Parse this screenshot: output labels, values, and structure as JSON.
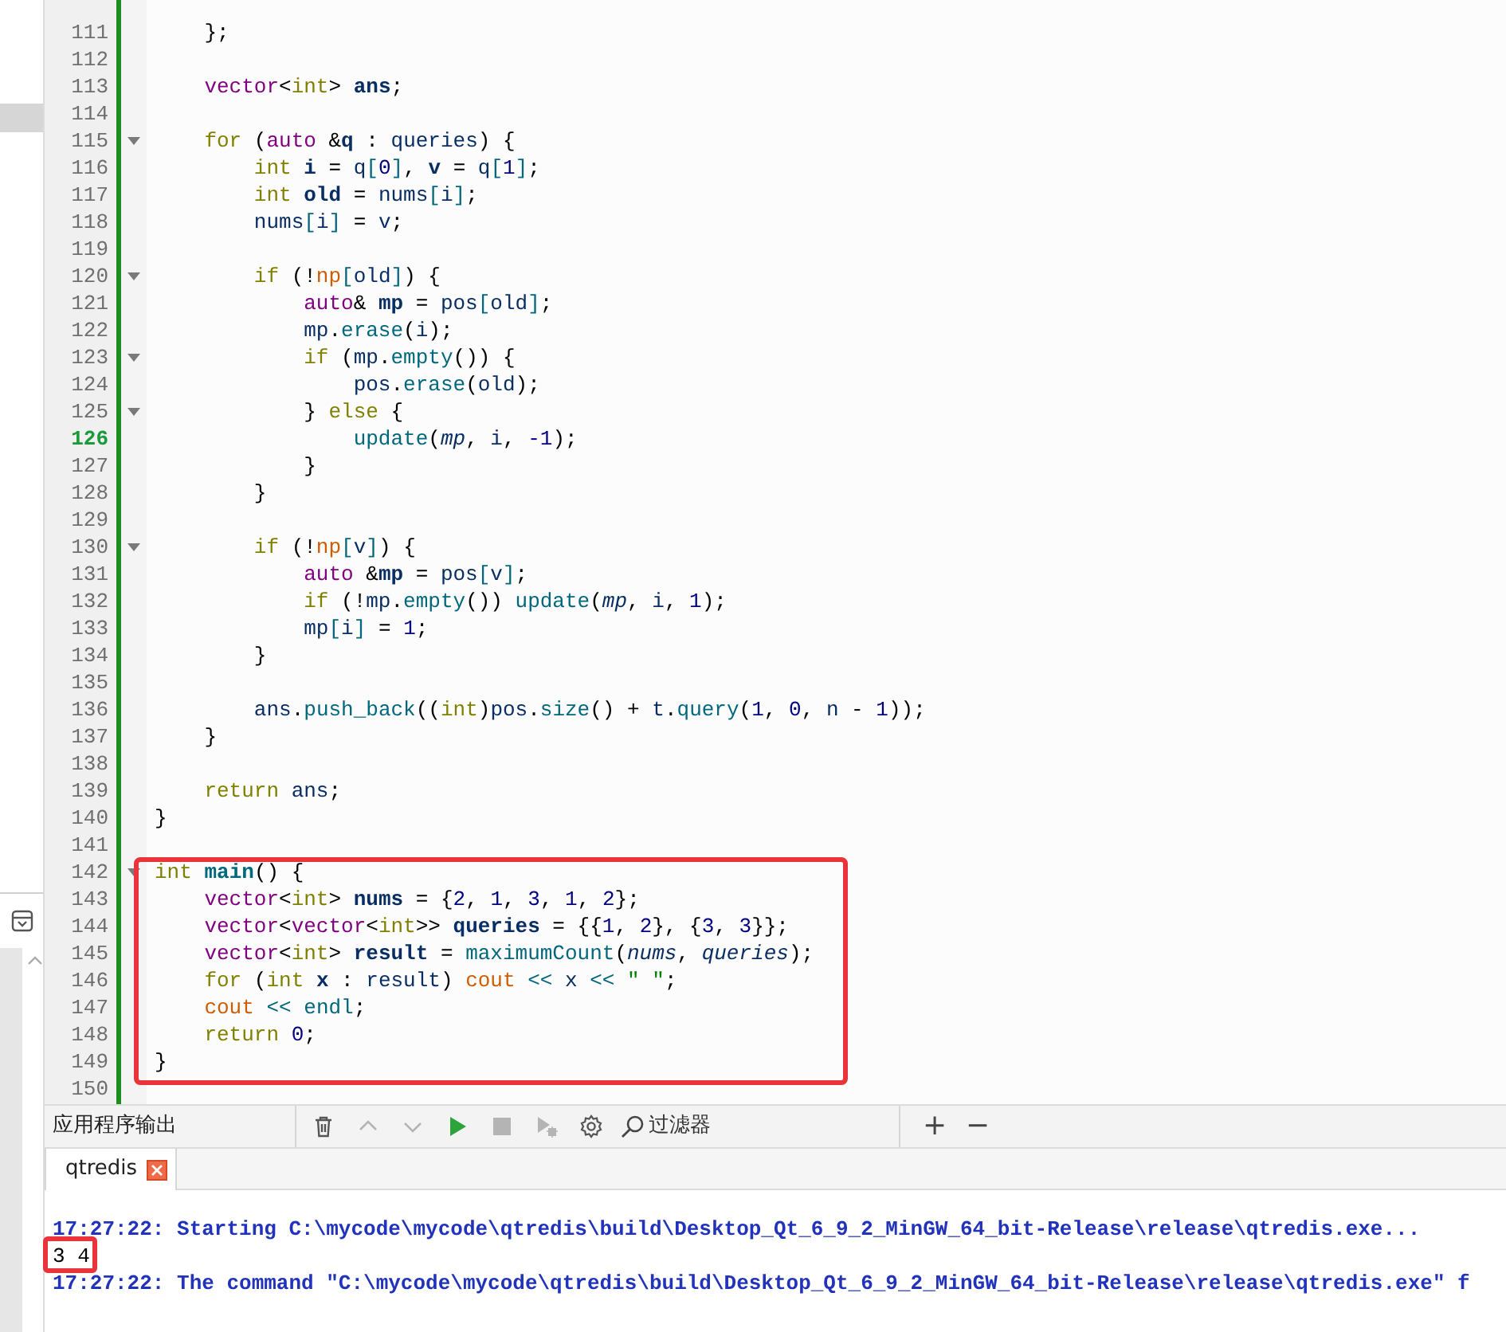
{
  "editor": {
    "sections": [
      {
        "boxed": false,
        "lines": [
          {
            "number": "111",
            "foldable": false,
            "current": false,
            "tokens": [
              {
                "text": "    };",
                "kind": "punct"
              }
            ]
          },
          {
            "number": "112",
            "foldable": false,
            "current": false
          },
          {
            "number": "113",
            "foldable": false,
            "current": false,
            "tokens": [
              {
                "text": "    vector",
                "kind": "type"
              },
              {
                "text": "<",
                "kind": "punct"
              },
              {
                "text": "int",
                "kind": "keyword"
              },
              {
                "text": "> ",
                "kind": "punct"
              },
              {
                "text": "ans",
                "kind": "decl"
              },
              {
                "text": ";",
                "kind": "punct"
              }
            ]
          },
          {
            "number": "114",
            "foldable": false,
            "current": false
          },
          {
            "number": "115",
            "foldable": true,
            "current": false,
            "tokens": [
              {
                "text": "    for",
                "kind": "keyword"
              },
              {
                "text": " (",
                "kind": "punct"
              },
              {
                "text": "auto",
                "kind": "type"
              },
              {
                "text": " &",
                "kind": "punct"
              },
              {
                "text": "q",
                "kind": "decl"
              },
              {
                "text": " : ",
                "kind": "punct"
              },
              {
                "text": "queries",
                "kind": "ident"
              },
              {
                "text": ") {",
                "kind": "punct"
              }
            ]
          },
          {
            "number": "116",
            "foldable": false,
            "current": false,
            "tokens": [
              {
                "text": "        int ",
                "kind": "keyword"
              },
              {
                "text": "i",
                "kind": "decl"
              },
              {
                "text": " = ",
                "kind": "punct"
              },
              {
                "text": "q",
                "kind": "ident"
              },
              {
                "text": "[",
                "kind": "func"
              },
              {
                "text": "0",
                "kind": "number"
              },
              {
                "text": "]",
                "kind": "func"
              },
              {
                "text": ", ",
                "kind": "punct"
              },
              {
                "text": "v",
                "kind": "decl"
              },
              {
                "text": " = ",
                "kind": "punct"
              },
              {
                "text": "q",
                "kind": "ident"
              },
              {
                "text": "[",
                "kind": "func"
              },
              {
                "text": "1",
                "kind": "number"
              },
              {
                "text": "]",
                "kind": "func"
              },
              {
                "text": ";",
                "kind": "punct"
              }
            ]
          },
          {
            "number": "117",
            "foldable": false,
            "current": false,
            "tokens": [
              {
                "text": "        int ",
                "kind": "keyword"
              },
              {
                "text": "old",
                "kind": "decl"
              },
              {
                "text": " = ",
                "kind": "punct"
              },
              {
                "text": "nums",
                "kind": "ident"
              },
              {
                "text": "[",
                "kind": "func"
              },
              {
                "text": "i",
                "kind": "ident"
              },
              {
                "text": "]",
                "kind": "func"
              },
              {
                "text": ";",
                "kind": "punct"
              }
            ]
          },
          {
            "number": "118",
            "foldable": false,
            "current": false,
            "tokens": [
              {
                "text": "        nums",
                "kind": "ident"
              },
              {
                "text": "[",
                "kind": "func"
              },
              {
                "text": "i",
                "kind": "ident"
              },
              {
                "text": "]",
                "kind": "func"
              },
              {
                "text": " = ",
                "kind": "punct"
              },
              {
                "text": "v",
                "kind": "ident"
              },
              {
                "text": ";",
                "kind": "punct"
              }
            ]
          },
          {
            "number": "119",
            "foldable": false,
            "current": false
          },
          {
            "number": "120",
            "foldable": true,
            "current": false,
            "tokens": [
              {
                "text": "        if",
                "kind": "keyword"
              },
              {
                "text": " (!",
                "kind": "punct"
              },
              {
                "text": "np",
                "kind": "global"
              },
              {
                "text": "[",
                "kind": "func"
              },
              {
                "text": "old",
                "kind": "ident"
              },
              {
                "text": "]",
                "kind": "func"
              },
              {
                "text": ") {",
                "kind": "punct"
              }
            ]
          },
          {
            "number": "121",
            "foldable": false,
            "current": false,
            "tokens": [
              {
                "text": "            auto",
                "kind": "type"
              },
              {
                "text": "& ",
                "kind": "punct"
              },
              {
                "text": "mp",
                "kind": "decl"
              },
              {
                "text": " = ",
                "kind": "punct"
              },
              {
                "text": "pos",
                "kind": "ident"
              },
              {
                "text": "[",
                "kind": "func"
              },
              {
                "text": "old",
                "kind": "ident"
              },
              {
                "text": "]",
                "kind": "func"
              },
              {
                "text": ";",
                "kind": "punct"
              }
            ]
          },
          {
            "number": "122",
            "foldable": false,
            "current": false,
            "tokens": [
              {
                "text": "            mp",
                "kind": "ident"
              },
              {
                "text": ".",
                "kind": "punct"
              },
              {
                "text": "erase",
                "kind": "func"
              },
              {
                "text": "(",
                "kind": "punct"
              },
              {
                "text": "i",
                "kind": "ident"
              },
              {
                "text": ");",
                "kind": "punct"
              }
            ]
          },
          {
            "number": "123",
            "foldable": true,
            "current": false,
            "tokens": [
              {
                "text": "            if",
                "kind": "keyword"
              },
              {
                "text": " (",
                "kind": "punct"
              },
              {
                "text": "mp",
                "kind": "ident"
              },
              {
                "text": ".",
                "kind": "punct"
              },
              {
                "text": "empty",
                "kind": "func"
              },
              {
                "text": "()) {",
                "kind": "punct"
              }
            ]
          },
          {
            "number": "124",
            "foldable": false,
            "current": false,
            "tokens": [
              {
                "text": "                pos",
                "kind": "ident"
              },
              {
                "text": ".",
                "kind": "punct"
              },
              {
                "text": "erase",
                "kind": "func"
              },
              {
                "text": "(",
                "kind": "punct"
              },
              {
                "text": "old",
                "kind": "ident"
              },
              {
                "text": ");",
                "kind": "punct"
              }
            ]
          },
          {
            "number": "125",
            "foldable": true,
            "current": false,
            "tokens": [
              {
                "text": "            } ",
                "kind": "punct"
              },
              {
                "text": "else",
                "kind": "keyword"
              },
              {
                "text": " {",
                "kind": "punct"
              }
            ]
          },
          {
            "number": "126",
            "foldable": false,
            "current": true,
            "tokens": [
              {
                "text": "                update",
                "kind": "func"
              },
              {
                "text": "(",
                "kind": "punct"
              },
              {
                "text": "mp",
                "kind": "param"
              },
              {
                "text": ", ",
                "kind": "punct"
              },
              {
                "text": "i",
                "kind": "ident"
              },
              {
                "text": ", ",
                "kind": "punct"
              },
              {
                "text": "-1",
                "kind": "number"
              },
              {
                "text": ");",
                "kind": "punct"
              }
            ]
          },
          {
            "number": "127",
            "foldable": false,
            "current": false,
            "tokens": [
              {
                "text": "            }",
                "kind": "punct"
              }
            ]
          },
          {
            "number": "128",
            "foldable": false,
            "current": false,
            "tokens": [
              {
                "text": "        }",
                "kind": "punct"
              }
            ]
          },
          {
            "number": "129",
            "foldable": false,
            "current": false
          },
          {
            "number": "130",
            "foldable": true,
            "current": false,
            "tokens": [
              {
                "text": "        if",
                "kind": "keyword"
              },
              {
                "text": " (!",
                "kind": "punct"
              },
              {
                "text": "np",
                "kind": "global"
              },
              {
                "text": "[",
                "kind": "func"
              },
              {
                "text": "v",
                "kind": "ident"
              },
              {
                "text": "]",
                "kind": "func"
              },
              {
                "text": ") {",
                "kind": "punct"
              }
            ]
          },
          {
            "number": "131",
            "foldable": false,
            "current": false,
            "tokens": [
              {
                "text": "            auto",
                "kind": "type"
              },
              {
                "text": " &",
                "kind": "punct"
              },
              {
                "text": "mp",
                "kind": "decl"
              },
              {
                "text": " = ",
                "kind": "punct"
              },
              {
                "text": "pos",
                "kind": "ident"
              },
              {
                "text": "[",
                "kind": "func"
              },
              {
                "text": "v",
                "kind": "ident"
              },
              {
                "text": "]",
                "kind": "func"
              },
              {
                "text": ";",
                "kind": "punct"
              }
            ]
          },
          {
            "number": "132",
            "foldable": false,
            "current": false,
            "tokens": [
              {
                "text": "            if",
                "kind": "keyword"
              },
              {
                "text": " (!",
                "kind": "punct"
              },
              {
                "text": "mp",
                "kind": "ident"
              },
              {
                "text": ".",
                "kind": "punct"
              },
              {
                "text": "empty",
                "kind": "func"
              },
              {
                "text": "()) ",
                "kind": "punct"
              },
              {
                "text": "update",
                "kind": "func"
              },
              {
                "text": "(",
                "kind": "punct"
              },
              {
                "text": "mp",
                "kind": "param"
              },
              {
                "text": ", ",
                "kind": "punct"
              },
              {
                "text": "i",
                "kind": "ident"
              },
              {
                "text": ", ",
                "kind": "punct"
              },
              {
                "text": "1",
                "kind": "number"
              },
              {
                "text": ");",
                "kind": "punct"
              }
            ]
          },
          {
            "number": "133",
            "foldable": false,
            "current": false,
            "tokens": [
              {
                "text": "            mp",
                "kind": "ident"
              },
              {
                "text": "[",
                "kind": "func"
              },
              {
                "text": "i",
                "kind": "ident"
              },
              {
                "text": "]",
                "kind": "func"
              },
              {
                "text": " = ",
                "kind": "punct"
              },
              {
                "text": "1",
                "kind": "number"
              },
              {
                "text": ";",
                "kind": "punct"
              }
            ]
          },
          {
            "number": "134",
            "foldable": false,
            "current": false,
            "tokens": [
              {
                "text": "        }",
                "kind": "punct"
              }
            ]
          },
          {
            "number": "135",
            "foldable": false,
            "current": false
          },
          {
            "number": "136",
            "foldable": false,
            "current": false,
            "tokens": [
              {
                "text": "        ans",
                "kind": "ident"
              },
              {
                "text": ".",
                "kind": "punct"
              },
              {
                "text": "push_back",
                "kind": "func"
              },
              {
                "text": "((",
                "kind": "punct"
              },
              {
                "text": "int",
                "kind": "keyword"
              },
              {
                "text": ")",
                "kind": "punct"
              },
              {
                "text": "pos",
                "kind": "ident"
              },
              {
                "text": ".",
                "kind": "punct"
              },
              {
                "text": "size",
                "kind": "func"
              },
              {
                "text": "() + ",
                "kind": "punct"
              },
              {
                "text": "t",
                "kind": "ident"
              },
              {
                "text": ".",
                "kind": "punct"
              },
              {
                "text": "query",
                "kind": "func"
              },
              {
                "text": "(",
                "kind": "punct"
              },
              {
                "text": "1",
                "kind": "number"
              },
              {
                "text": ", ",
                "kind": "punct"
              },
              {
                "text": "0",
                "kind": "number"
              },
              {
                "text": ", ",
                "kind": "punct"
              },
              {
                "text": "n",
                "kind": "ident"
              },
              {
                "text": " - ",
                "kind": "punct"
              },
              {
                "text": "1",
                "kind": "number"
              },
              {
                "text": "));",
                "kind": "punct"
              }
            ]
          },
          {
            "number": "137",
            "foldable": false,
            "current": false,
            "tokens": [
              {
                "text": "    }",
                "kind": "punct"
              }
            ]
          },
          {
            "number": "138",
            "foldable": false,
            "current": false
          },
          {
            "number": "139",
            "foldable": false,
            "current": false,
            "tokens": [
              {
                "text": "    return ",
                "kind": "keyword"
              },
              {
                "text": "ans",
                "kind": "ident"
              },
              {
                "text": ";",
                "kind": "punct"
              }
            ]
          },
          {
            "number": "140",
            "foldable": false,
            "current": false,
            "tokens": [
              {
                "text": "}",
                "kind": "punct"
              }
            ]
          },
          {
            "number": "141",
            "foldable": false,
            "current": false
          }
        ]
      },
      {
        "boxed": true,
        "lines": [
          {
            "number": "142",
            "foldable": true,
            "current": false,
            "tokens": [
              {
                "text": "int ",
                "kind": "keyword"
              },
              {
                "text": "main",
                "kind": "funcdecl"
              },
              {
                "text": "() {",
                "kind": "punct"
              }
            ]
          },
          {
            "number": "143",
            "foldable": false,
            "current": false,
            "tokens": [
              {
                "text": "    vector",
                "kind": "type"
              },
              {
                "text": "<",
                "kind": "punct"
              },
              {
                "text": "int",
                "kind": "keyword"
              },
              {
                "text": "> ",
                "kind": "punct"
              },
              {
                "text": "nums",
                "kind": "decl"
              },
              {
                "text": " = {",
                "kind": "punct"
              },
              {
                "text": "2",
                "kind": "number"
              },
              {
                "text": ", ",
                "kind": "punct"
              },
              {
                "text": "1",
                "kind": "number"
              },
              {
                "text": ", ",
                "kind": "punct"
              },
              {
                "text": "3",
                "kind": "number"
              },
              {
                "text": ", ",
                "kind": "punct"
              },
              {
                "text": "1",
                "kind": "number"
              },
              {
                "text": ", ",
                "kind": "punct"
              },
              {
                "text": "2",
                "kind": "number"
              },
              {
                "text": "};",
                "kind": "punct"
              }
            ]
          },
          {
            "number": "144",
            "foldable": false,
            "current": false,
            "tokens": [
              {
                "text": "    vector",
                "kind": "type"
              },
              {
                "text": "<",
                "kind": "punct"
              },
              {
                "text": "vector",
                "kind": "type"
              },
              {
                "text": "<",
                "kind": "punct"
              },
              {
                "text": "int",
                "kind": "keyword"
              },
              {
                "text": ">> ",
                "kind": "punct"
              },
              {
                "text": "queries",
                "kind": "decl"
              },
              {
                "text": " = {{",
                "kind": "punct"
              },
              {
                "text": "1",
                "kind": "number"
              },
              {
                "text": ", ",
                "kind": "punct"
              },
              {
                "text": "2",
                "kind": "number"
              },
              {
                "text": "}, {",
                "kind": "punct"
              },
              {
                "text": "3",
                "kind": "number"
              },
              {
                "text": ", ",
                "kind": "punct"
              },
              {
                "text": "3",
                "kind": "number"
              },
              {
                "text": "}};",
                "kind": "punct"
              }
            ]
          },
          {
            "number": "145",
            "foldable": false,
            "current": false,
            "tokens": [
              {
                "text": "    vector",
                "kind": "type"
              },
              {
                "text": "<",
                "kind": "punct"
              },
              {
                "text": "int",
                "kind": "keyword"
              },
              {
                "text": "> ",
                "kind": "punct"
              },
              {
                "text": "result",
                "kind": "decl"
              },
              {
                "text": " = ",
                "kind": "punct"
              },
              {
                "text": "maximumCount",
                "kind": "func"
              },
              {
                "text": "(",
                "kind": "punct"
              },
              {
                "text": "nums",
                "kind": "param"
              },
              {
                "text": ", ",
                "kind": "punct"
              },
              {
                "text": "queries",
                "kind": "param"
              },
              {
                "text": ");",
                "kind": "punct"
              }
            ]
          },
          {
            "number": "146",
            "foldable": false,
            "current": false,
            "tokens": [
              {
                "text": "    for",
                "kind": "keyword"
              },
              {
                "text": " (",
                "kind": "punct"
              },
              {
                "text": "int ",
                "kind": "keyword"
              },
              {
                "text": "x",
                "kind": "decl"
              },
              {
                "text": " : ",
                "kind": "punct"
              },
              {
                "text": "result",
                "kind": "ident"
              },
              {
                "text": ") ",
                "kind": "punct"
              },
              {
                "text": "cout",
                "kind": "global"
              },
              {
                "text": " << ",
                "kind": "func"
              },
              {
                "text": "x",
                "kind": "ident"
              },
              {
                "text": " << ",
                "kind": "func"
              },
              {
                "text": "\" \"",
                "kind": "string"
              },
              {
                "text": ";",
                "kind": "punct"
              }
            ]
          },
          {
            "number": "147",
            "foldable": false,
            "current": false,
            "tokens": [
              {
                "text": "    cout",
                "kind": "global"
              },
              {
                "text": " << ",
                "kind": "func"
              },
              {
                "text": "endl",
                "kind": "func"
              },
              {
                "text": ";",
                "kind": "punct"
              }
            ]
          },
          {
            "number": "148",
            "foldable": false,
            "current": false,
            "tokens": [
              {
                "text": "    return ",
                "kind": "keyword"
              },
              {
                "text": "0",
                "kind": "number"
              },
              {
                "text": ";",
                "kind": "punct"
              }
            ]
          },
          {
            "number": "149",
            "foldable": false,
            "current": false,
            "tokens": [
              {
                "text": "}",
                "kind": "punct"
              }
            ]
          }
        ]
      },
      {
        "boxed": false,
        "lines": [
          {
            "number": "150",
            "foldable": false,
            "current": false
          }
        ]
      }
    ]
  },
  "output_pane": {
    "title": "应用程序输出",
    "toolbar": [
      {
        "kind": "clear",
        "disabled": false
      },
      {
        "kind": "up",
        "disabled": true
      },
      {
        "kind": "down",
        "disabled": true
      },
      {
        "kind": "run",
        "disabled": false
      },
      {
        "kind": "stop",
        "disabled": true
      },
      {
        "kind": "attach",
        "disabled": true
      },
      {
        "kind": "settings",
        "disabled": false
      }
    ],
    "filter": {
      "placeholder": "过滤器"
    },
    "zoom_buttons": [
      "+",
      "−"
    ],
    "tabs": [
      {
        "label": "qtredis",
        "selected": true
      }
    ],
    "lines": [
      {
        "kind": "message",
        "boxed": false,
        "text": "17:27:22: Starting C:\\mycode\\mycode\\qtredis\\build\\Desktop_Qt_6_9_2_MinGW_64_bit-Release\\release\\qtredis.exe..."
      },
      {
        "kind": "stdout",
        "boxed": true,
        "text": "3 4"
      },
      {
        "kind": "message",
        "boxed": false,
        "text": "17:27:22: The command \"C:\\mycode\\mycode\\qtredis\\build\\Desktop_Qt_6_9_2_MinGW_64_bit-Release\\release\\qtredis.exe\" f"
      }
    ]
  }
}
